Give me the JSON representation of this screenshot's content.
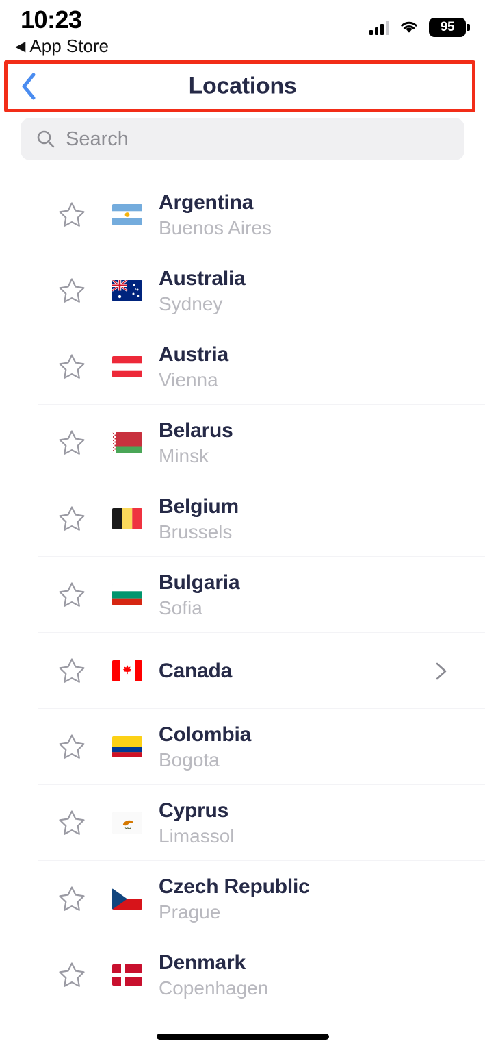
{
  "status_bar": {
    "time": "10:23",
    "back_app_label": "App Store",
    "back_triangle": "◀",
    "battery_percent": "95",
    "icons": [
      "cellular-signal-icon",
      "wifi-icon",
      "battery-icon"
    ]
  },
  "nav": {
    "title": "Locations",
    "back_icon": "chevron-left-icon",
    "highlight_color": "#f22d18",
    "title_color": "#262a47",
    "back_color": "#4a8cf0"
  },
  "search": {
    "placeholder": "Search",
    "value": "",
    "icon": "search-icon"
  },
  "list": {
    "rows": [
      {
        "country": "Argentina",
        "city": "Buenos Aires",
        "flag": "argentina-flag",
        "star": "star-outline-icon",
        "chevron": false,
        "divider": false
      },
      {
        "country": "Australia",
        "city": "Sydney",
        "flag": "australia-flag",
        "star": "star-outline-icon",
        "chevron": false,
        "divider": false
      },
      {
        "country": "Austria",
        "city": "Vienna",
        "flag": "austria-flag",
        "star": "star-outline-icon",
        "chevron": false,
        "divider": true
      },
      {
        "country": "Belarus",
        "city": "Minsk",
        "flag": "belarus-flag",
        "star": "star-outline-icon",
        "chevron": false,
        "divider": false
      },
      {
        "country": "Belgium",
        "city": "Brussels",
        "flag": "belgium-flag",
        "star": "star-outline-icon",
        "chevron": false,
        "divider": true
      },
      {
        "country": "Bulgaria",
        "city": "Sofia",
        "flag": "bulgaria-flag",
        "star": "star-outline-icon",
        "chevron": false,
        "divider": true
      },
      {
        "country": "Canada",
        "city": "",
        "flag": "canada-flag",
        "star": "star-outline-icon",
        "chevron": true,
        "divider": true
      },
      {
        "country": "Colombia",
        "city": "Bogota",
        "flag": "colombia-flag",
        "star": "star-outline-icon",
        "chevron": false,
        "divider": true
      },
      {
        "country": "Cyprus",
        "city": "Limassol",
        "flag": "cyprus-flag",
        "star": "star-outline-icon",
        "chevron": false,
        "divider": true
      },
      {
        "country": "Czech Republic",
        "city": "Prague",
        "flag": "czech-republic-flag",
        "star": "star-outline-icon",
        "chevron": false,
        "divider": false
      },
      {
        "country": "Denmark",
        "city": "Copenhagen",
        "flag": "denmark-flag",
        "star": "star-outline-icon",
        "chevron": false,
        "divider": false
      }
    ]
  },
  "home_indicator": "home-indicator"
}
